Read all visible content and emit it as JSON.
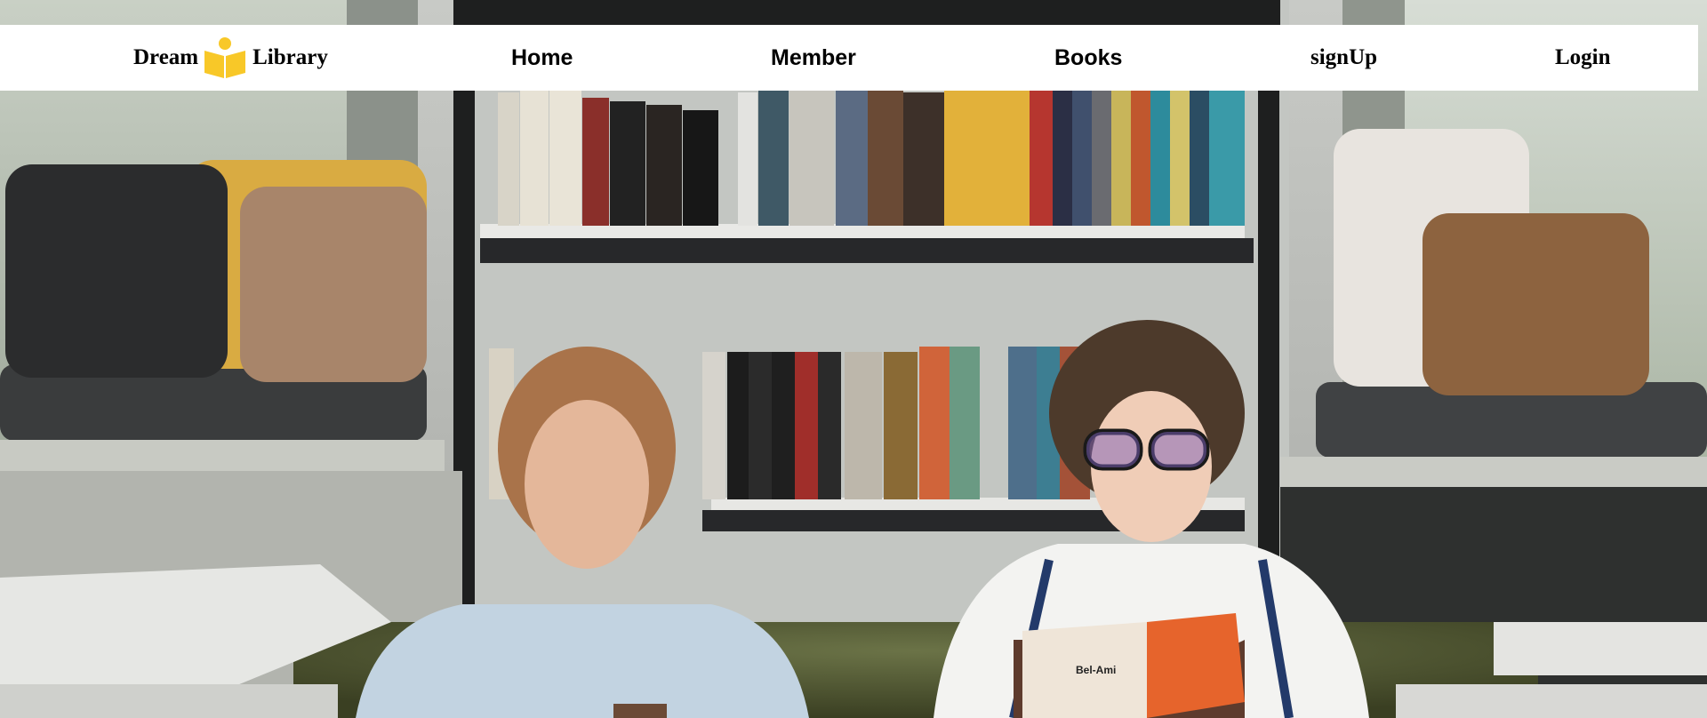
{
  "brand": {
    "word1": "Dream",
    "word2": "Library",
    "logo_icon": "reading-person-icon",
    "logo_color": "#F8C828"
  },
  "nav": {
    "home": "Home",
    "member": "Member",
    "books": "Books",
    "signup": "signUp",
    "login": "Login"
  },
  "hero": {
    "image_subject": "two-people-reading-in-library-photo",
    "book_title_visible": "Bel-Ami"
  }
}
